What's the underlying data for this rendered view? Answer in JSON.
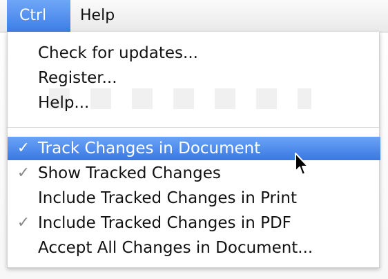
{
  "menubar": {
    "items": [
      {
        "label": "Ctrl",
        "selected": true
      },
      {
        "label": "Help",
        "selected": false
      }
    ]
  },
  "menu": {
    "group1": [
      {
        "label": "Check for updates..."
      },
      {
        "label": "Register..."
      },
      {
        "label": "Help..."
      }
    ],
    "group2": [
      {
        "label": "Track Changes in Document",
        "checked": true,
        "highlighted": true
      },
      {
        "label": "Show Tracked Changes",
        "checked": true,
        "highlighted": false
      },
      {
        "label": "Include Tracked Changes in Print",
        "checked": false,
        "highlighted": false
      },
      {
        "label": "Include Tracked Changes in PDF",
        "checked": true,
        "highlighted": false
      },
      {
        "label": "Accept All Changes in Document...",
        "checked": false,
        "highlighted": false
      }
    ],
    "check_glyph": "✓"
  },
  "colors": {
    "highlight": "#3a78e2",
    "check": "#888888"
  },
  "icons": {
    "cursor": "pointer-arrow-icon"
  }
}
